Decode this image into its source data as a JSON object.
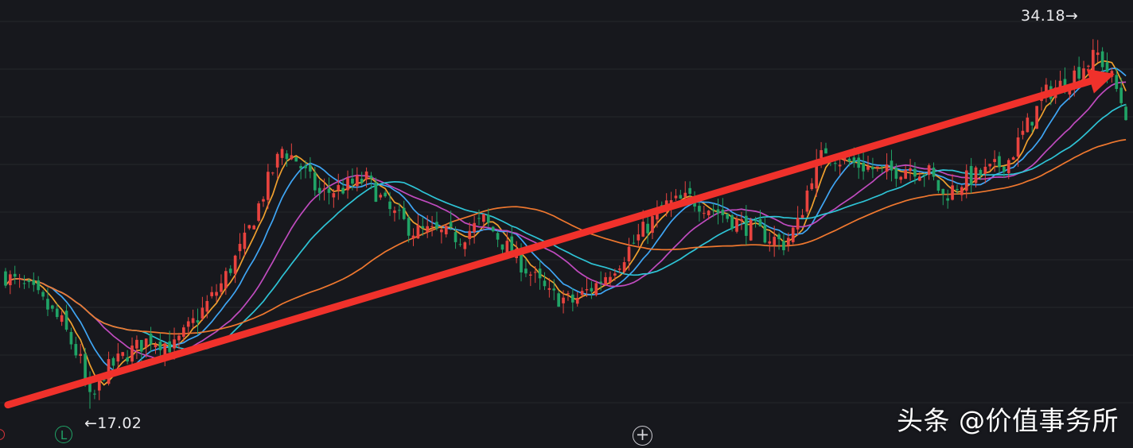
{
  "chart_data": {
    "type": "candlestick",
    "title": "",
    "xlabel": "",
    "ylabel": "",
    "ylim": [
      16.3,
      35.3
    ],
    "annotations": {
      "low_label": "←17.02",
      "high_label": "34.18→",
      "low_value": 17.02,
      "high_value": 34.18,
      "trend_arrow": {
        "from": [
          0.5,
          17.2
        ],
        "to": [
          236.6,
          32.6
        ],
        "color": "#f0312b"
      }
    },
    "grid": true,
    "candles": {
      "count": 240,
      "close_anchors": [
        [
          0,
          23.2
        ],
        [
          6,
          22.4
        ],
        [
          12,
          21.0
        ],
        [
          16,
          19.2
        ],
        [
          18,
          17.4
        ],
        [
          19,
          17.6
        ],
        [
          21,
          18.7
        ],
        [
          26,
          19.6
        ],
        [
          31,
          20.3
        ],
        [
          36,
          19.9
        ],
        [
          41,
          21.3
        ],
        [
          46,
          22.8
        ],
        [
          51,
          24.8
        ],
        [
          56,
          27.6
        ],
        [
          59,
          29.1
        ],
        [
          62,
          28.6
        ],
        [
          67,
          27.0
        ],
        [
          72,
          27.3
        ],
        [
          77,
          27.7
        ],
        [
          82,
          26.2
        ],
        [
          87,
          25.3
        ],
        [
          92,
          25.2
        ],
        [
          97,
          25.0
        ],
        [
          102,
          25.8
        ],
        [
          107,
          24.5
        ],
        [
          112,
          23.3
        ],
        [
          116,
          22.3
        ],
        [
          121,
          22.0
        ],
        [
          126,
          22.8
        ],
        [
          131,
          23.9
        ],
        [
          136,
          25.3
        ],
        [
          141,
          26.5
        ],
        [
          146,
          26.8
        ],
        [
          151,
          26.3
        ],
        [
          156,
          25.7
        ],
        [
          161,
          25.2
        ],
        [
          166,
          24.7
        ],
        [
          169,
          25.6
        ],
        [
          172,
          27.9
        ],
        [
          175,
          29.1
        ],
        [
          178,
          28.6
        ],
        [
          183,
          28.3
        ],
        [
          188,
          28.0
        ],
        [
          193,
          28.3
        ],
        [
          197,
          28.0
        ],
        [
          200,
          26.9
        ],
        [
          204,
          27.6
        ],
        [
          210,
          28.1
        ],
        [
          214,
          28.6
        ],
        [
          218,
          30.2
        ],
        [
          222,
          31.7
        ],
        [
          226,
          32.2
        ],
        [
          230,
          33.0
        ],
        [
          233,
          33.5
        ],
        [
          236,
          32.4
        ],
        [
          239,
          30.8
        ]
      ]
    },
    "series": [
      {
        "name": "",
        "period": 5,
        "color": "#f0a02e"
      },
      {
        "name": "",
        "period": 10,
        "color": "#3fa6f5"
      },
      {
        "name": "",
        "period": 20,
        "color": "#c04bbf"
      },
      {
        "name": "",
        "period": 30,
        "color": "#2ec4d6"
      },
      {
        "name": "",
        "period": 60,
        "color": "#f0782f"
      }
    ],
    "colors": {
      "up": "#e8433f",
      "down": "#20a366",
      "background": "#17181d",
      "grid": "#26272c"
    }
  },
  "ui": {
    "badge_letter": "L",
    "plus_symbol": "+",
    "watermark": "头条 @价值事务所"
  }
}
